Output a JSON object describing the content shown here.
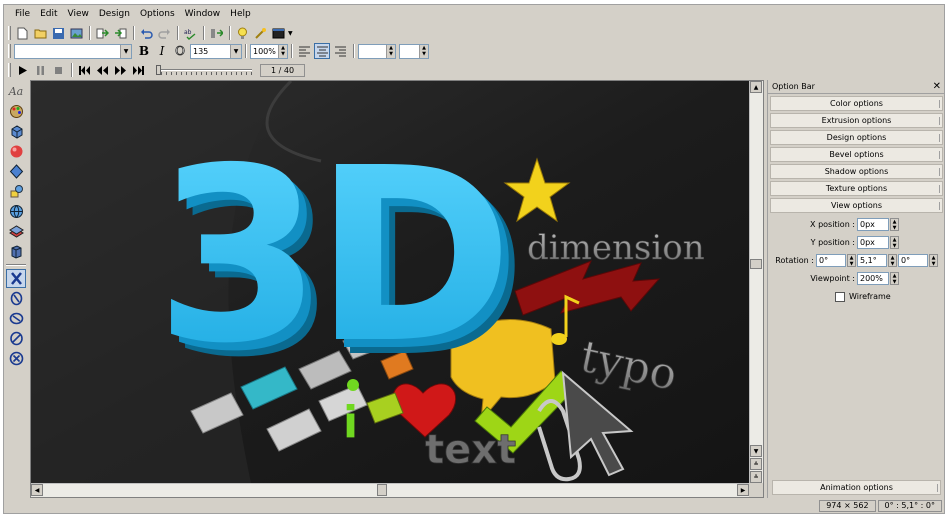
{
  "menu": [
    "File",
    "Edit",
    "View",
    "Design",
    "Options",
    "Window",
    "Help"
  ],
  "toolbar": {
    "font_name": "",
    "bold": "B",
    "italic": "I",
    "outline": "O",
    "font_size": "135",
    "zoom": "100%",
    "extra1": "",
    "extra2": ""
  },
  "playback": {
    "frame": "1 / 40",
    "slider_position": 0.0
  },
  "left_tools": {
    "text_tool": "Aa"
  },
  "canvas": {
    "logo_text": "3D",
    "word_dimension": "dimension",
    "word_typo": "typo",
    "word_text": "text",
    "info_letter": "i"
  },
  "option_bar": {
    "title": "Option Bar",
    "close": "✕",
    "sections": [
      "Color options",
      "Extrusion options",
      "Design options",
      "Bevel options",
      "Shadow options",
      "Texture options",
      "View options"
    ],
    "view": {
      "x_label": "X position :",
      "x_value": "0px",
      "y_label": "Y position :",
      "y_value": "0px",
      "rot_label": "Rotation :",
      "rot_x": "0°",
      "rot_y": "5,1°",
      "rot_z": "0°",
      "viewpoint_label": "Viewpoint :",
      "viewpoint_value": "200%",
      "wireframe_label": "Wireframe"
    },
    "animation": "Animation options"
  },
  "status": {
    "size": "974 × 562",
    "angles": "0° : 5,1° : 0°"
  },
  "colors": {
    "logo_blue": "#2ec0f0",
    "star_yellow": "#f2d21c",
    "arrow_red": "#8e1010",
    "heart_red": "#d01818",
    "check_green": "#9ed616",
    "chat_yellow": "#f0c020"
  }
}
